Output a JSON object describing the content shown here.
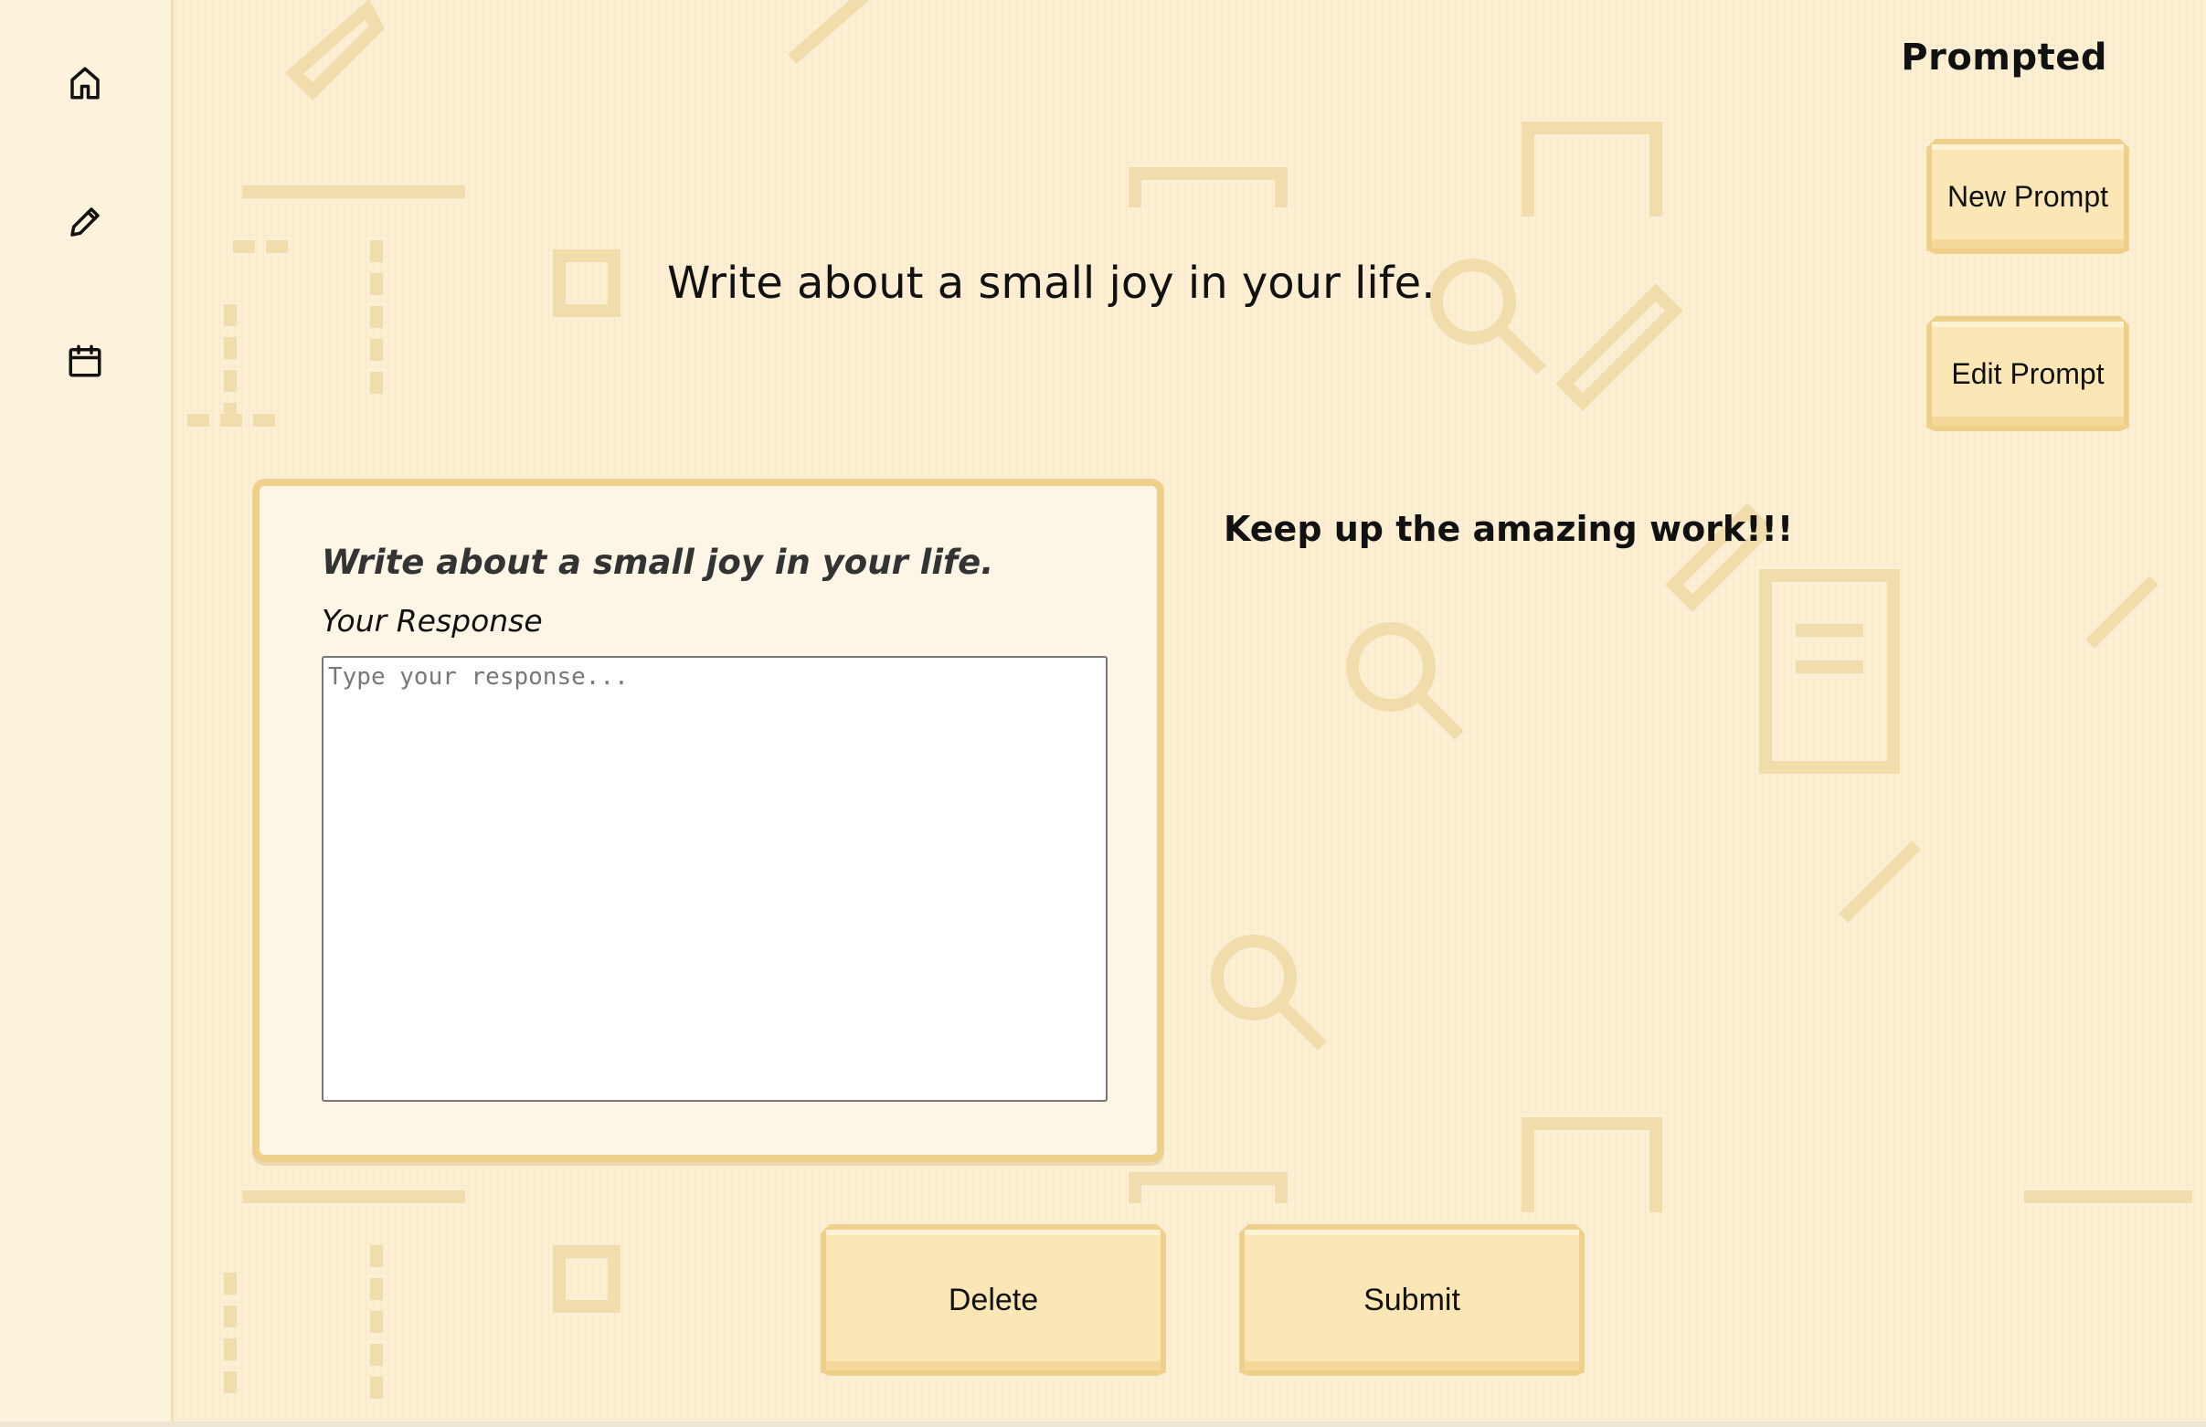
{
  "app": {
    "title": "Prompted"
  },
  "sidebar": {
    "items": [
      {
        "name": "home",
        "icon": "home-icon"
      },
      {
        "name": "write",
        "icon": "pencil-icon"
      },
      {
        "name": "calendar",
        "icon": "calendar-icon"
      }
    ]
  },
  "actions": {
    "new_prompt_label": "New Prompt",
    "edit_prompt_label": "Edit Prompt",
    "delete_label": "Delete",
    "submit_label": "Submit"
  },
  "prompt": {
    "text": "Write about a small joy in your life."
  },
  "card": {
    "title": "Write about a small joy in your life.",
    "label": "Your Response",
    "placeholder": "Type your response...",
    "value": ""
  },
  "encouragement": "Keep up the amazing work!!!",
  "colors": {
    "background": "#fcefd3",
    "accent": "#efd08a",
    "button": "#fbe7b6",
    "card": "#fdf5e5"
  }
}
